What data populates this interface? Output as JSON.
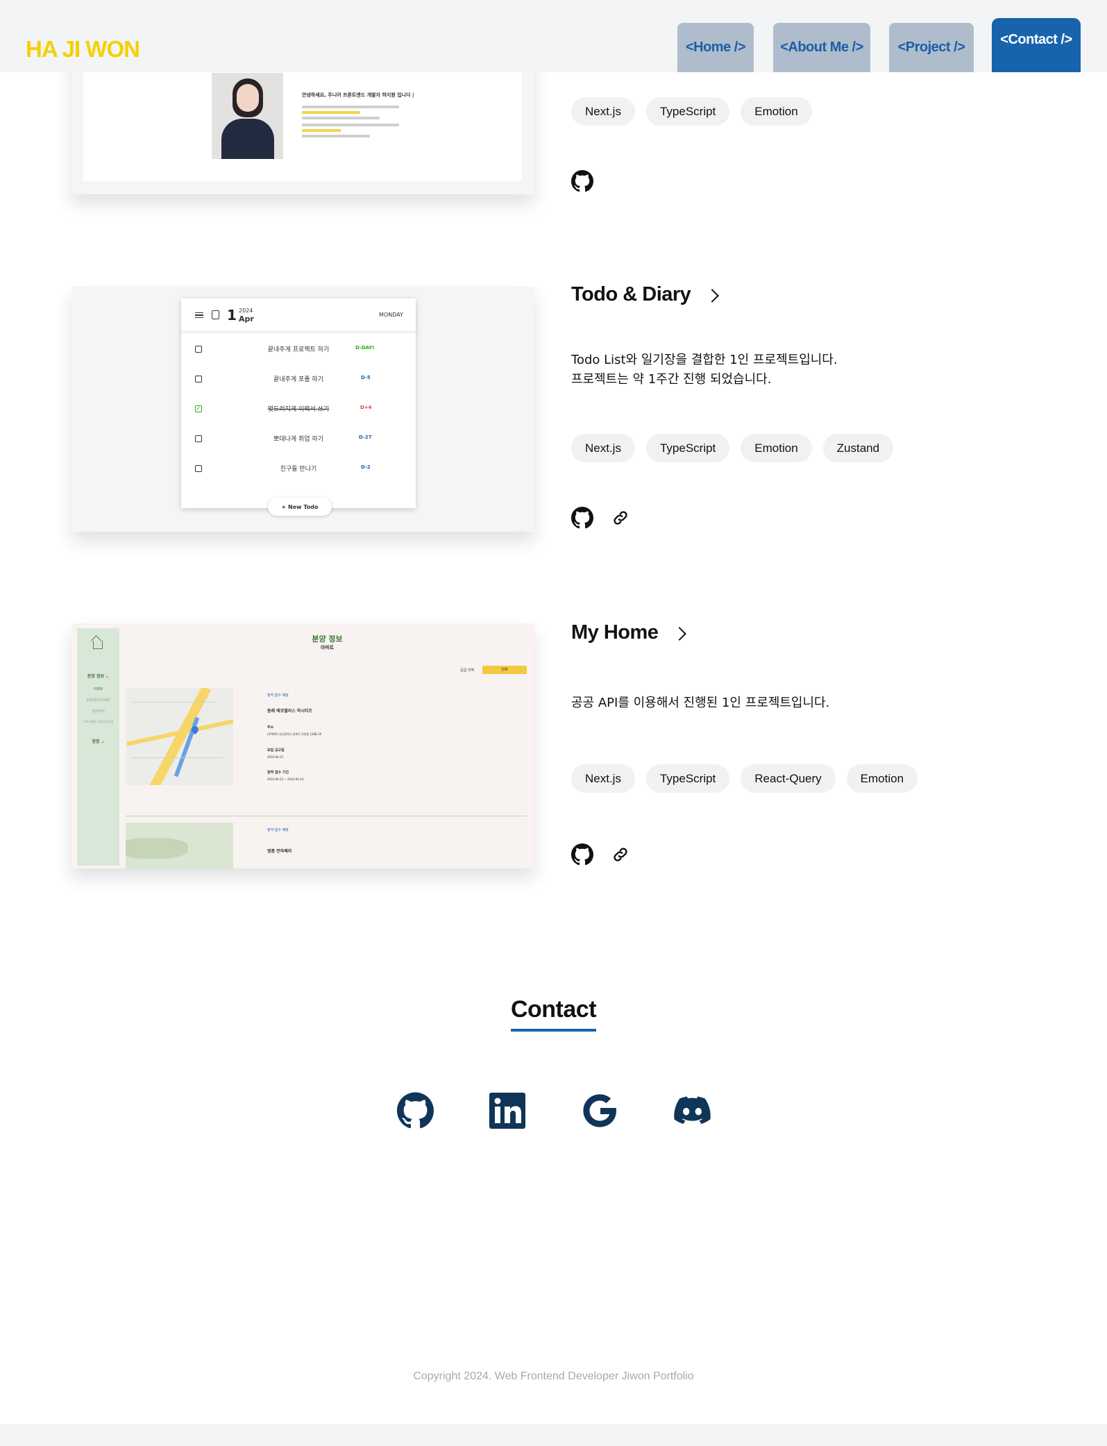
{
  "header": {
    "logo": "HA JI WON",
    "nav": [
      {
        "label": "<Home />"
      },
      {
        "label": "<About Me />"
      },
      {
        "label": "<Project />"
      },
      {
        "label": "<Contact />",
        "active": true
      }
    ],
    "colors": {
      "logo": "#f5d000",
      "accent": "#1764ad",
      "tab_inactive": "#aebccc"
    }
  },
  "projects": [
    {
      "title": "",
      "tags": [
        "Next.js",
        "TypeScript",
        "Emotion"
      ],
      "links": [
        "github-icon"
      ],
      "thumb": {
        "intro": "안녕하세요, 주니어 프론트엔드 개발자 하지원 입니다 |"
      }
    },
    {
      "title": "Todo & Diary",
      "description": [
        "Todo List와 일기장을 결합한 1인 프로젝트입니다.",
        "프로젝트는 약 1주간 진행 되었습니다."
      ],
      "tags": [
        "Next.js",
        "TypeScript",
        "Emotion",
        "Zustand"
      ],
      "links": [
        "github-icon",
        "link-icon"
      ],
      "thumb": {
        "day": "1",
        "year": "2024",
        "month": "Apr",
        "weekday": "MONDAY",
        "todos": [
          {
            "text": "끝내주게 프로젝트 하기",
            "due": "D-DAY!",
            "done": false
          },
          {
            "text": "끝내주게 포폴 하기",
            "due": "D-5",
            "done": false
          },
          {
            "text": "멋드러지게 이력서 쓰기",
            "due": "D+4",
            "done": true
          },
          {
            "text": "뽀대나게 취업 하기",
            "due": "D-27",
            "done": false
          },
          {
            "text": "친구들 만나기",
            "due": "D-2",
            "done": false
          }
        ],
        "new_button": "+ New Todo"
      }
    },
    {
      "title": "My Home",
      "description": [
        "공공 API를 이용해서 진행된 1인 프로젝트입니다."
      ],
      "tags": [
        "Next.js",
        "TypeScript",
        "React-Query",
        "Emotion"
      ],
      "links": [
        "github-icon",
        "link-icon"
      ],
      "thumb": {
        "heading": "분양 정보",
        "sub": "아파트",
        "side": [
          "분양 정보 ⌄",
          "아파트",
          "무순위/잔여세대",
          "임대주택",
          "오피스텔/도시형/민간임대",
          "정정 ⌄"
        ],
        "filter_label": "공급 지역",
        "filter_value": "전체",
        "items": [
          {
            "badge": "청약 접수 예정",
            "name": "동래 에코델리스 하시티즈"
          },
          {
            "label": "주소",
            "value": "(47065) 부산광역시 동래구 온천동 1288-10"
          },
          {
            "label": "모집 공고일",
            "value": "2024-04-22"
          },
          {
            "label": "청약 접수 기간",
            "value": "2024-04-22 ~ 2024-04-24"
          }
        ],
        "item2": {
          "badge": "청약 접수 예정",
          "name": "명품 전하쎄리"
        }
      }
    }
  ],
  "contact": {
    "title": "Contact",
    "icons": [
      "github-icon",
      "linkedin-icon",
      "google-icon",
      "discord-icon"
    ]
  },
  "footer": {
    "copyright": "Copyright 2024. Web Frontend Developer Jiwon Portfolio"
  }
}
